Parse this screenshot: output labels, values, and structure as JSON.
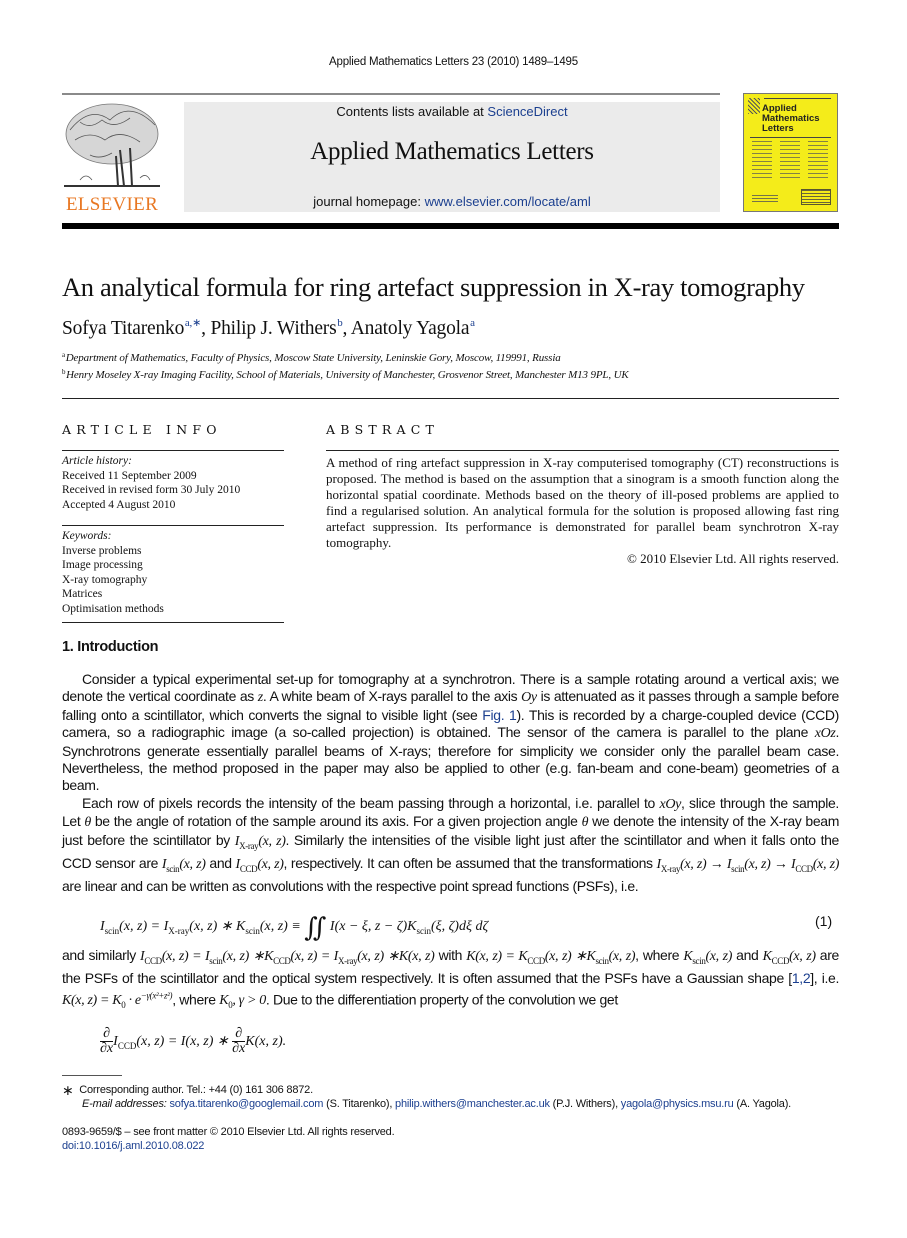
{
  "running_head": "Applied Mathematics Letters 23 (2010) 1489–1495",
  "masthead": {
    "contents_prefix": "Contents lists available at ",
    "contents_link": "ScienceDirect",
    "journal_title": "Applied Mathematics Letters",
    "homepage_prefix": "journal homepage: ",
    "homepage_link": "www.elsevier.com/locate/aml",
    "publisher_wordmark": "ELSEVIER",
    "cover_title_lines": [
      "Applied",
      "Mathematics",
      "Letters"
    ]
  },
  "colors": {
    "link": "#1b3f8f",
    "elsevier_orange": "#e87722",
    "cover_yellow": "#f4ec1a",
    "masthead_bg": "#ebebeb"
  },
  "article": {
    "title": "An analytical formula for ring artefact suppression in X-ray tomography",
    "authors": [
      {
        "name": "Sofya Titarenko",
        "sup": "a,∗"
      },
      {
        "name": "Philip J. Withers",
        "sup": "b"
      },
      {
        "name": "Anatoly Yagola",
        "sup": "a"
      }
    ],
    "affiliations": [
      {
        "mark": "a",
        "text": "Department of Mathematics, Faculty of Physics, Moscow State University, Leninskie Gory, Moscow, 119991, Russia"
      },
      {
        "mark": "b",
        "text": "Henry Moseley X-ray Imaging Facility, School of Materials, University of Manchester, Grosvenor Street, Manchester M13 9PL, UK"
      }
    ]
  },
  "article_info": {
    "heading": "ARTICLE INFO",
    "history_label": "Article history:",
    "history": [
      "Received 11 September 2009",
      "Received in revised form 30 July 2010",
      "Accepted 4 August 2010"
    ],
    "keywords_label": "Keywords:",
    "keywords": [
      "Inverse problems",
      "Image processing",
      "X-ray tomography",
      "Matrices",
      "Optimisation methods"
    ]
  },
  "abstract": {
    "heading": "ABSTRACT",
    "text": "A method of ring artefact suppression in X-ray computerised tomography (CT) reconstructions is proposed. The method is based on the assumption that a sinogram is a smooth function along the horizontal spatial coordinate. Methods based on the theory of ill-posed problems are applied to find a regularised solution. An analytical formula for the solution is proposed allowing fast ring artefact suppression. Its performance is demonstrated for parallel beam synchrotron X-ray tomography.",
    "copyright": "© 2010 Elsevier Ltd. All rights reserved."
  },
  "introduction": {
    "heading": "1. Introduction",
    "p1": {
      "a": "Consider a typical experimental set-up for tomography at a synchrotron. There is a sample rotating around a vertical axis; we denote the vertical coordinate as ",
      "z": "z",
      "b": ". A white beam of X-rays parallel to the axis ",
      "oy": "Oy",
      "c": " is attenuated as it passes through a sample before falling onto a scintillator, which converts the signal to visible light (see ",
      "fig_link": "Fig. 1",
      "d": "). This is recorded by a charge-coupled device (CCD) camera, so a radiographic image (a so-called projection) is obtained. The sensor of the camera is parallel to the plane ",
      "xoz": "xOz",
      "e": ". Synchrotrons generate essentially parallel beams of X-rays; therefore for simplicity we consider only the parallel beam case. Nevertheless, the method proposed in the paper may also be applied to other (e.g. fan-beam and cone-beam) geometries of a beam."
    },
    "p2": {
      "a": "Each row of pixels records the intensity of the beam passing through a horizontal, i.e. parallel to ",
      "xoy": "xOy",
      "b": ", slice through the sample. Let ",
      "theta": "θ",
      "c": " be the angle of rotation of the sample around its axis. For a given projection angle ",
      "d": " we denote the intensity of the X-ray beam just before the scintillator by ",
      "e": ". Similarly the intensities of the visible light just after the scintillator and when it falls onto the CCD sensor are ",
      "and": " and ",
      "f": ", respectively. It can often be assumed that the transformations ",
      "g": " are linear and can be written as convolutions with the respective point spread functions (PSFs), i.e."
    },
    "eq1_number": "(1)",
    "p3": {
      "a": "and similarly ",
      "b": " with ",
      "c": ", where ",
      "d": " and ",
      "e": " are the PSFs of the scintillator and the optical system respectively. It is often assumed that the PSFs have a Gaussian shape [",
      "refs": "1,2",
      "f": "], i.e. ",
      "g": ", where ",
      "h": ". Due to the differentiation property of the convolution we get"
    }
  },
  "footnotes": {
    "corresponding": "Corresponding author. Tel.: +44 (0) 161 306 8872.",
    "emails_label": "E-mail addresses: ",
    "emails": [
      {
        "email": "sofya.titarenko@googlemail.com",
        "who": " (S. Titarenko), "
      },
      {
        "email": "philip.withers@manchester.ac.uk",
        "who": " (P.J. Withers), "
      },
      {
        "email": "yagola@physics.msu.ru",
        "who": " (A. Yagola)."
      }
    ],
    "issn_line": "0893-9659/$ – see front matter © 2010 Elsevier Ltd. All rights reserved.",
    "doi": "doi:10.1016/j.aml.2010.08.022"
  }
}
